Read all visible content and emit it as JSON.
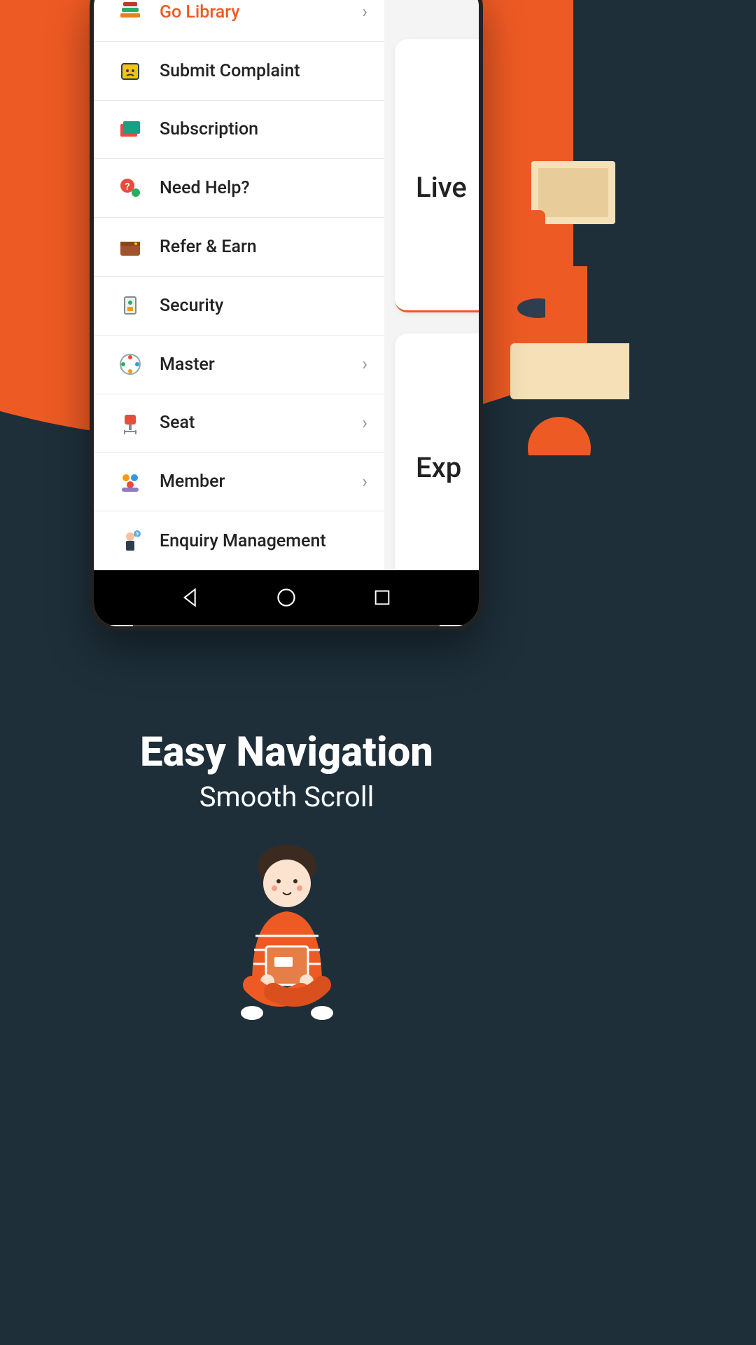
{
  "nav": {
    "items": [
      {
        "label": "Go Library",
        "icon": "books-icon",
        "highlight": true,
        "chevron": true
      },
      {
        "label": "Submit Complaint",
        "icon": "complaint-icon",
        "highlight": false,
        "chevron": false
      },
      {
        "label": "Subscription",
        "icon": "wallet-icon",
        "highlight": false,
        "chevron": false
      },
      {
        "label": "Need Help?",
        "icon": "help-icon",
        "highlight": false,
        "chevron": false
      },
      {
        "label": "Refer & Earn",
        "icon": "refer-icon",
        "highlight": false,
        "chevron": false
      },
      {
        "label": "Security",
        "icon": "security-icon",
        "highlight": false,
        "chevron": false
      },
      {
        "label": "Master",
        "icon": "master-icon",
        "highlight": false,
        "chevron": true
      },
      {
        "label": "Seat",
        "icon": "seat-icon",
        "highlight": false,
        "chevron": true
      },
      {
        "label": "Member",
        "icon": "member-icon",
        "highlight": false,
        "chevron": true
      },
      {
        "label": "Enquiry Management",
        "icon": "enquiry-icon",
        "highlight": false,
        "chevron": false
      }
    ]
  },
  "main": {
    "card1_text": "Live",
    "card2_text": "Exp"
  },
  "marketing": {
    "title": "Easy Navigation",
    "subtitle": "Smooth Scroll"
  },
  "colors": {
    "accent": "#ee5a24",
    "dark_bg": "#1e2f3a"
  }
}
